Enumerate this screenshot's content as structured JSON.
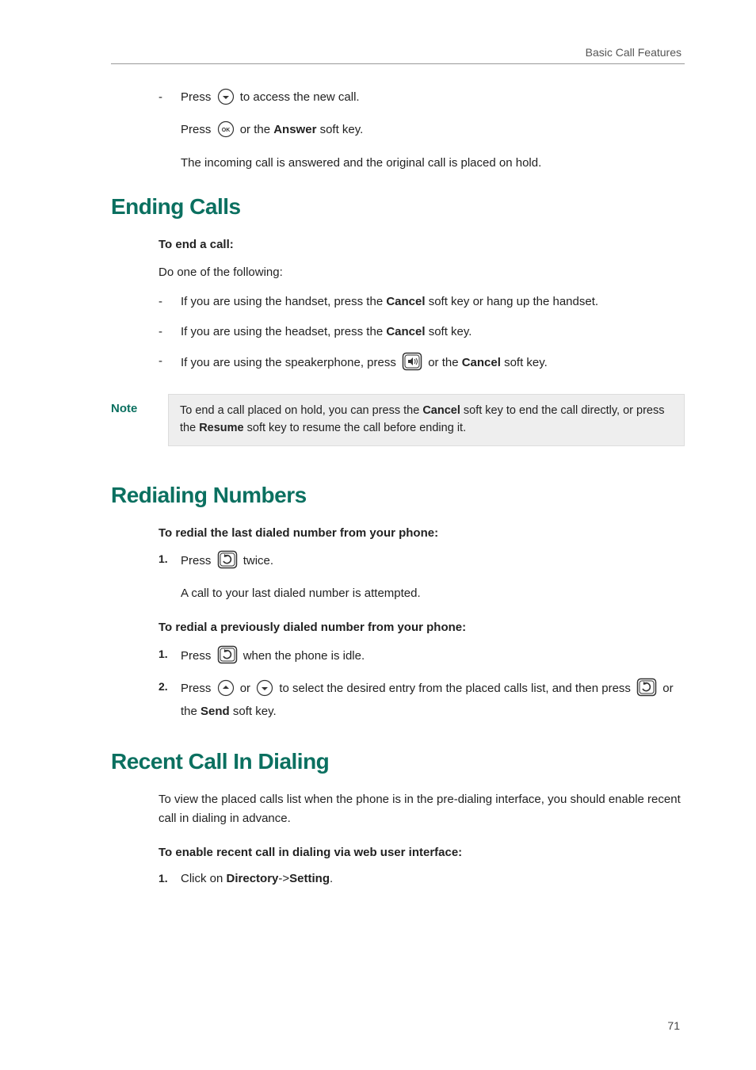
{
  "header": {
    "title": "Basic Call Features"
  },
  "intro_block": {
    "line1_pre": "Press ",
    "line1_post": " to access the new call.",
    "line2_pre": "Press ",
    "line2_mid": " or the ",
    "line2_bold": "Answer",
    "line2_post": " soft key.",
    "line3": "The incoming call is answered and the original call is placed on hold."
  },
  "h1_ending": "Ending Calls",
  "ending": {
    "sub": "To end a call:",
    "lead": "Do one of the following:",
    "item1a": "If you are using the handset, press the ",
    "item1b": "Cancel",
    "item1c": " soft key or hang up the handset.",
    "item2a": "If you are using the headset, press the ",
    "item2b": "Cancel",
    "item2c": " soft key.",
    "item3a": "If you are using the speakerphone, press ",
    "item3b": " or the ",
    "item3c": "Cancel",
    "item3d": " soft key."
  },
  "note": {
    "label": "Note",
    "t1": "To end a call placed on hold, you can press the ",
    "t2": "Cancel",
    "t3": " soft key to end the call directly, or press the ",
    "t4": "Resume",
    "t5": " soft key to resume the call before ending it."
  },
  "h1_redial": "Redialing Numbers",
  "redial": {
    "sub1": "To redial the last dialed number from your phone:",
    "s1a": "Press ",
    "s1b": " twice.",
    "s1c": "A call to your last dialed number is attempted.",
    "sub2": "To redial a previously dialed number from your phone:",
    "s2a": "Press ",
    "s2b": " when the phone is idle.",
    "s3a": "Press ",
    "s3b": " or ",
    "s3c": " to select the desired entry from the placed calls list, and then press ",
    "s3d": " or the ",
    "s3e": "Send",
    "s3f": " soft key."
  },
  "h1_recent": "Recent Call In Dialing",
  "recent": {
    "p1": "To view the placed calls list when the phone is in the pre-dialing interface, you should enable recent call in dialing in advance.",
    "sub": "To enable recent call in dialing via web user interface:",
    "s1a": "Click on ",
    "s1b": "Directory",
    "s1c": "->",
    "s1d": "Setting",
    "s1e": "."
  },
  "page_num": "71"
}
